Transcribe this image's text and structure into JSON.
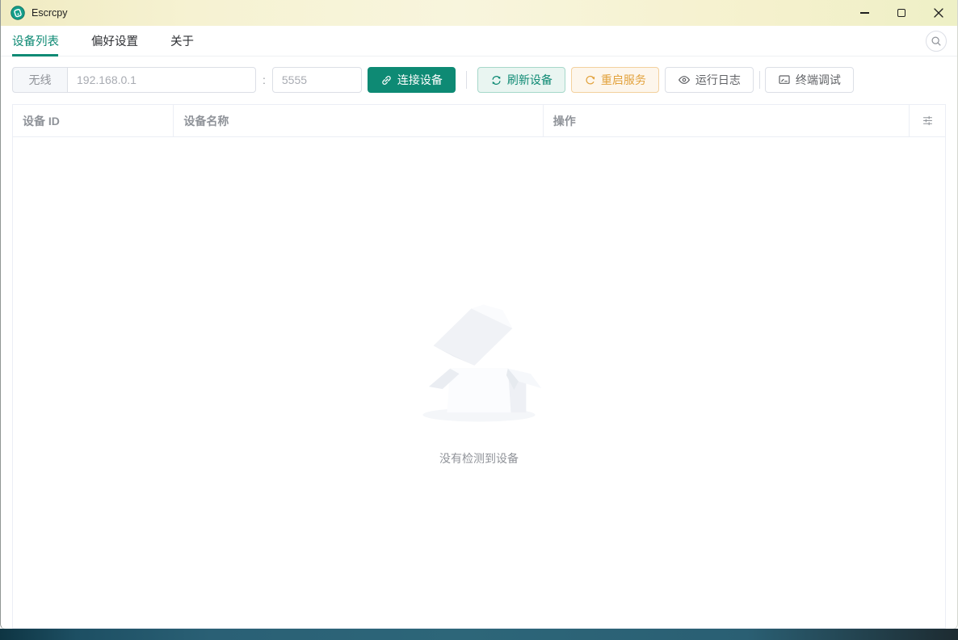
{
  "window": {
    "title": "Escrcpy"
  },
  "tabs": {
    "items": [
      {
        "label": "设备列表",
        "active": true
      },
      {
        "label": "偏好设置",
        "active": false
      },
      {
        "label": "关于",
        "active": false
      }
    ]
  },
  "toolbar": {
    "wireless_label": "无线",
    "ip_placeholder": "192.168.0.1",
    "separator": ":",
    "port_placeholder": "5555",
    "connect_label": "连接设备",
    "refresh_label": "刷新设备",
    "restart_label": "重启服务",
    "logs_label": "运行日志",
    "terminal_label": "终端调试"
  },
  "device_table": {
    "columns": [
      {
        "label": "设备 ID"
      },
      {
        "label": "设备名称"
      },
      {
        "label": "操作"
      }
    ],
    "empty_text": "没有检测到设备"
  },
  "icons": {
    "app_logo": "escrcpy-teal-circle",
    "search": "magnifier",
    "connect": "link",
    "refresh": "circular-arrows",
    "restart": "refresh-right",
    "logs": "eye",
    "terminal": "monitor",
    "column_settings": "sliders",
    "minimize": "horizontal-line",
    "maximize": "square-outline",
    "close": "x-cross"
  },
  "colors": {
    "primary": "#0e8a74",
    "warning": "#e2a23d",
    "titlebar": "#f6f2d2",
    "taskbar": "#2a6075"
  }
}
